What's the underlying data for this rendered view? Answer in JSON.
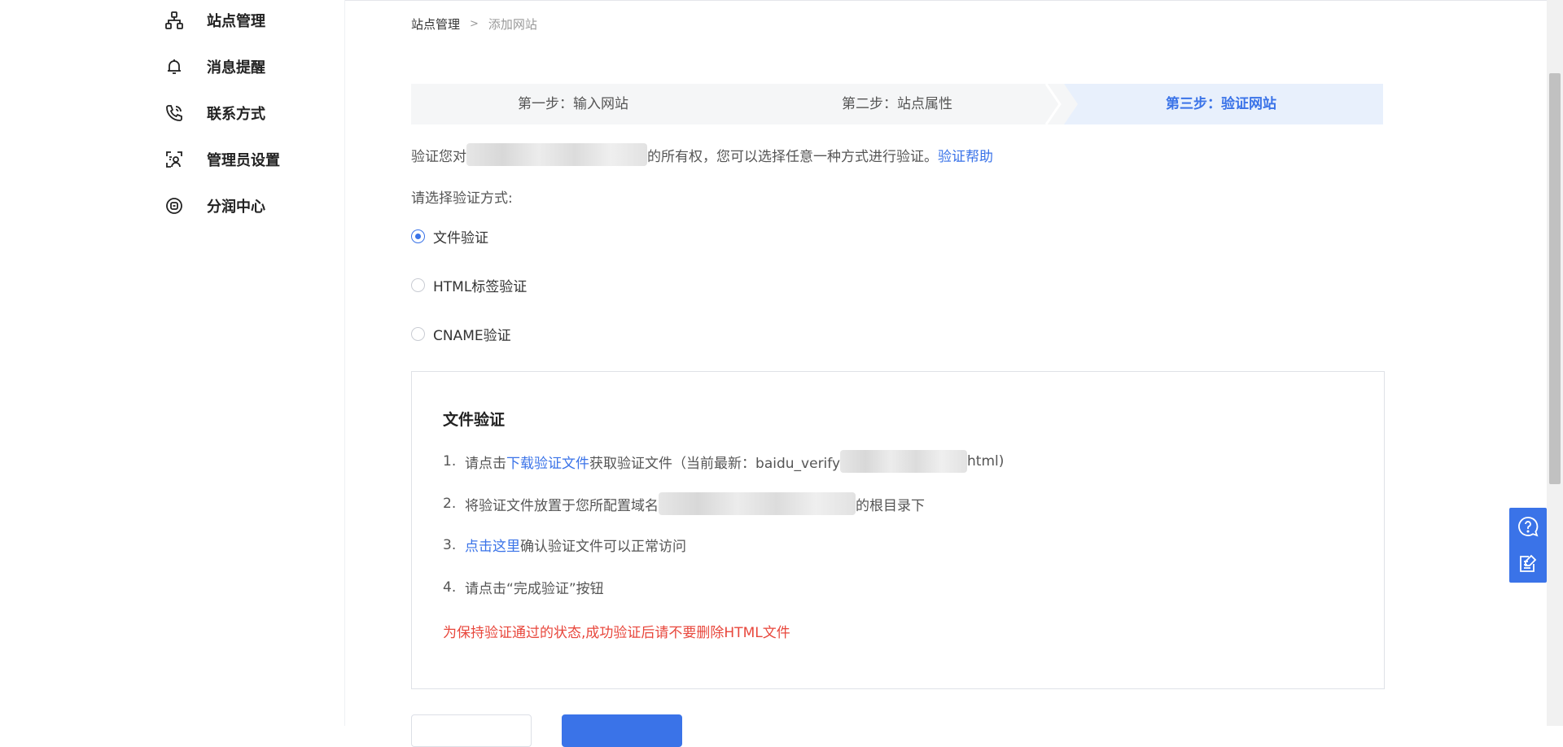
{
  "sidebar": {
    "items": [
      {
        "label": "站点管理",
        "icon": "sitemap-icon"
      },
      {
        "label": "消息提醒",
        "icon": "bell-icon"
      },
      {
        "label": "联系方式",
        "icon": "phone-icon"
      },
      {
        "label": "管理员设置",
        "icon": "admin-icon"
      },
      {
        "label": "分润中心",
        "icon": "revenue-icon"
      }
    ]
  },
  "breadcrumb": {
    "parent": "站点管理",
    "separator": ">",
    "current": "添加网站"
  },
  "steps": [
    {
      "label": "第一步：输入网站",
      "active": false
    },
    {
      "label": "第二步：站点属性",
      "active": false
    },
    {
      "label": "第三步：验证网站",
      "active": true
    }
  ],
  "verify": {
    "desc_prefix": "验证您对",
    "desc_suffix": "的所有权，您可以选择任意一种方式进行验证。",
    "help_link": "验证帮助",
    "choose_label": "请选择验证方式:",
    "methods": [
      {
        "label": "文件验证",
        "checked": true
      },
      {
        "label": "HTML标签验证",
        "checked": false
      },
      {
        "label": "CNAME验证",
        "checked": false
      }
    ]
  },
  "panel": {
    "title": "文件验证",
    "step1_num": "1.",
    "step1_prefix": "请点击",
    "step1_link": "下载验证文件",
    "step1_mid": "获取验证文件（当前最新：baidu_verify",
    "step1_end": "html)",
    "step2_num": "2.",
    "step2_prefix": "将验证文件放置于您所配置域名",
    "step2_suffix": "的根目录下",
    "step3_num": "3.",
    "step3_link": "点击这里",
    "step3_suffix": "确认验证文件可以正常访问",
    "step4_num": "4.",
    "step4_text": "请点击“完成验证”按钮",
    "warning": "为保持验证通过的状态,成功验证后请不要删除HTML文件"
  },
  "float_tools": {
    "help_icon": "help-chat-icon",
    "feedback_icon": "feedback-icon"
  },
  "colors": {
    "accent": "#3a73e8",
    "warning": "#e8473c",
    "step_bg": "#f5f6f7",
    "step_active_bg": "#e8f0fc"
  }
}
